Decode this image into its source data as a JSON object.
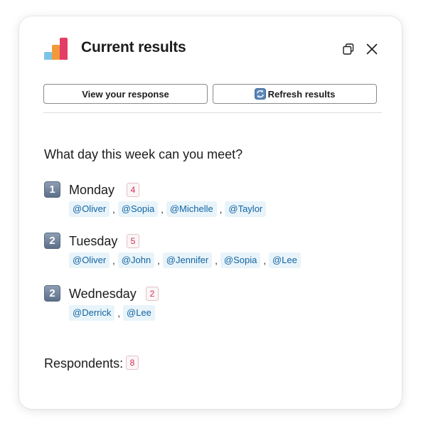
{
  "header": {
    "title": "Current results",
    "copy_icon": "copy-icon",
    "close_icon": "close-icon"
  },
  "actions": {
    "view_label": "View your response",
    "refresh_label": "Refresh results",
    "refresh_icon": "refresh-icon"
  },
  "poll": {
    "question": "What day this week can you meet?",
    "options": [
      {
        "rank": "1",
        "label": "Monday",
        "count": "4",
        "voters": [
          "@Oliver",
          "@Sopia",
          "@Michelle",
          "@Taylor"
        ]
      },
      {
        "rank": "2",
        "label": "Tuesday",
        "count": "5",
        "voters": [
          "@Oliver",
          "@John",
          "@Jennifer",
          "@Sopia",
          "@Lee"
        ]
      },
      {
        "rank": "2",
        "label": "Wednesday",
        "count": "2",
        "voters": [
          "@Derrick",
          "@Lee"
        ]
      }
    ]
  },
  "respondents": {
    "label": "Respondents:",
    "count": "8"
  },
  "colors": {
    "mention_bg": "#e8f4fa",
    "mention_text": "#1264a3",
    "count_text": "#d0305a",
    "logo": [
      "#7cc3e7",
      "#f29a3b",
      "#e43d66"
    ]
  }
}
